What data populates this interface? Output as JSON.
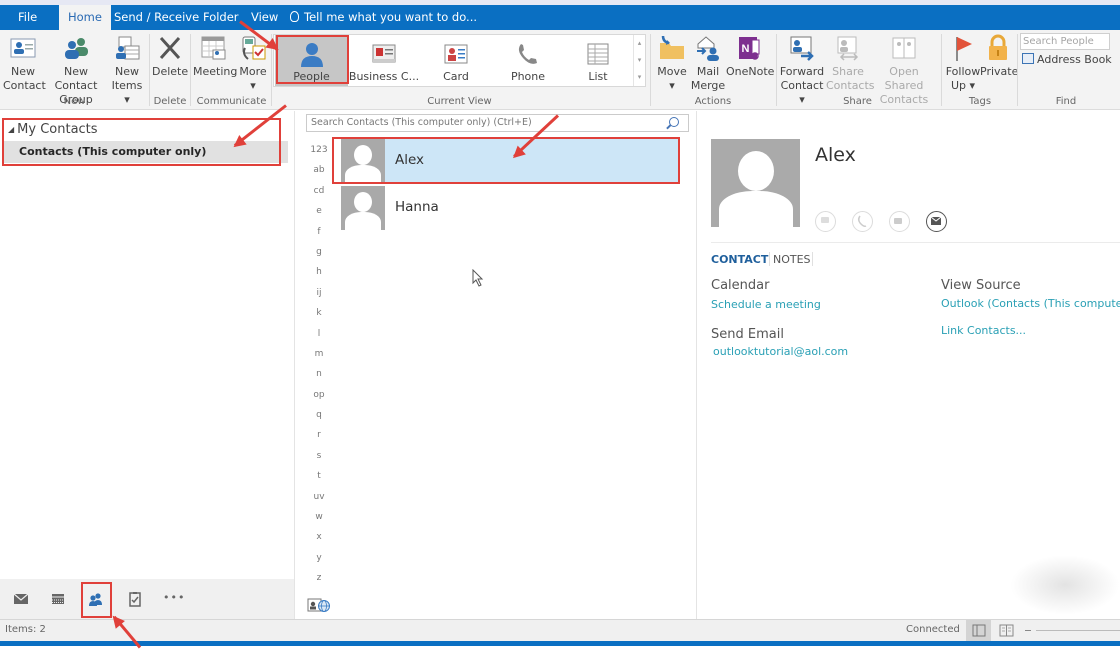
{
  "tabs": [
    {
      "label": "File",
      "active": false
    },
    {
      "label": "Home",
      "active": true
    },
    {
      "label": "Send / Receive",
      "active": false
    },
    {
      "label": "Folder",
      "active": false
    },
    {
      "label": "View",
      "active": false
    }
  ],
  "tell_me": "Tell me what you want to do...",
  "ribbon": {
    "new_group": {
      "label": "New",
      "buttons": [
        {
          "line1": "New",
          "line2": "Contact",
          "icon": "contact-card-icon"
        },
        {
          "line1": "New Contact",
          "line2": "Group",
          "icon": "contact-group-icon"
        },
        {
          "line1": "New",
          "line2": "Items ▾",
          "icon": "new-items-icon"
        }
      ]
    },
    "delete_group": {
      "label": "Delete",
      "buttons": [
        {
          "line1": "Delete",
          "icon": "x-icon"
        }
      ]
    },
    "communicate_group": {
      "label": "Communicate",
      "buttons": [
        {
          "line1": "Meeting",
          "icon": "meeting-icon"
        },
        {
          "line1": "More",
          "line2": "▾",
          "icon": "more-icon"
        }
      ]
    },
    "current_view_group": {
      "label": "Current View",
      "views": [
        {
          "label": "People",
          "selected": true,
          "icon": "person-icon"
        },
        {
          "label": "Business C...",
          "selected": false,
          "icon": "business-card-icon"
        },
        {
          "label": "Card",
          "selected": false,
          "icon": "card-icon"
        },
        {
          "label": "Phone",
          "selected": false,
          "icon": "phone-icon"
        },
        {
          "label": "List",
          "selected": false,
          "icon": "list-icon"
        }
      ]
    },
    "actions_group": {
      "label": "Actions",
      "buttons": [
        {
          "line1": "Move",
          "line2": "▾",
          "icon": "folder-move-icon"
        },
        {
          "line1": "Mail",
          "line2": "Merge",
          "icon": "mail-merge-icon"
        },
        {
          "line1": "OneNote",
          "icon": "onenote-icon"
        }
      ]
    },
    "share_group": {
      "label": "Share",
      "buttons": [
        {
          "line1": "Forward",
          "line2": "Contact ▾",
          "icon": "forward-contact-icon",
          "disabled": false
        },
        {
          "line1": "Share",
          "line2": "Contacts",
          "icon": "share-contacts-icon",
          "disabled": true
        },
        {
          "line1": "Open Shared",
          "line2": "Contacts",
          "icon": "open-shared-icon",
          "disabled": true
        }
      ]
    },
    "tags_group": {
      "label": "Tags",
      "buttons": [
        {
          "line1": "Follow",
          "line2": "Up ▾",
          "icon": "flag-icon"
        },
        {
          "line1": "Private",
          "icon": "lock-icon"
        }
      ]
    },
    "find_group": {
      "label": "Find",
      "search_placeholder": "Search People",
      "address_book": "Address Book"
    }
  },
  "folder_pane": {
    "header": "My Contacts",
    "folders": [
      {
        "label": "Contacts (This computer only)",
        "selected": true
      }
    ]
  },
  "nav": {
    "items": [
      {
        "name": "mail",
        "active": false
      },
      {
        "name": "calendar",
        "active": false
      },
      {
        "name": "people",
        "active": true
      },
      {
        "name": "tasks",
        "active": false
      },
      {
        "name": "more",
        "active": false,
        "glyph": "•••"
      }
    ]
  },
  "list": {
    "search_placeholder": "Search Contacts (This computer only) (Ctrl+E)",
    "alphabet": [
      "123",
      "ab",
      "cd",
      "e",
      "f",
      "g",
      "h",
      "ij",
      "k",
      "l",
      "m",
      "n",
      "op",
      "q",
      "r",
      "s",
      "t",
      "uv",
      "w",
      "x",
      "y",
      "z"
    ],
    "contacts": [
      {
        "name": "Alex",
        "selected": true
      },
      {
        "name": "Hanna",
        "selected": false
      }
    ]
  },
  "reading": {
    "name": "Alex",
    "tabs": [
      {
        "label": "CONTACT",
        "active": true
      },
      {
        "label": "NOTES",
        "active": false
      }
    ],
    "calendar_heading": "Calendar",
    "calendar_link": "Schedule a meeting",
    "email_heading": "Send Email",
    "email": "outlooktutorial@aol.com",
    "source_heading": "View Source",
    "source_link": "Outlook (Contacts (This computer on",
    "link_contacts": "Link Contacts..."
  },
  "status": {
    "items": "Items: 2",
    "connection": "Connected"
  },
  "colors": {
    "brand": "#0a6fc2",
    "highlight": "#e0403a",
    "selection": "#cde6f7",
    "link": "#2aa0b5"
  }
}
